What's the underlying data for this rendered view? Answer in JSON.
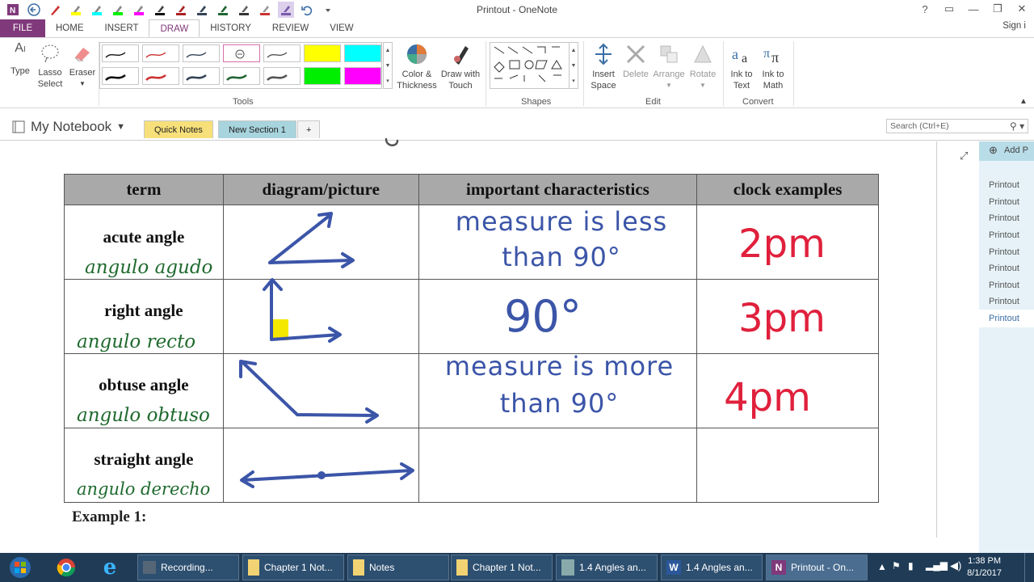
{
  "window": {
    "title": "Printout - OneNote"
  },
  "signin": "Sign i",
  "tabs": [
    "FILE",
    "HOME",
    "INSERT",
    "DRAW",
    "HISTORY",
    "REVIEW",
    "VIEW"
  ],
  "ribbon": {
    "type": "Type",
    "lasso": "Lasso Select",
    "eraser": "Eraser",
    "color_thickness_1": "Color &",
    "color_thickness_2": "Thickness",
    "draw_touch_1": "Draw with",
    "draw_touch_2": "Touch",
    "insert_space_1": "Insert",
    "insert_space_2": "Space",
    "delete": "Delete",
    "arrange": "Arrange",
    "rotate": "Rotate",
    "ink_text_1": "Ink to",
    "ink_text_2": "Text",
    "ink_math_1": "Ink to",
    "ink_math_2": "Math",
    "groups": {
      "tools": "Tools",
      "shapes": "Shapes",
      "edit": "Edit",
      "convert": "Convert"
    }
  },
  "nav": {
    "notebook": "My Notebook",
    "sections": [
      "Quick Notes",
      "New Section 1"
    ],
    "add": "+",
    "search_placeholder": "Search (Ctrl+E)"
  },
  "pages": {
    "add": "Add P",
    "items": [
      "Printout",
      "Printout",
      "Printout",
      "Printout",
      "Printout",
      "Printout",
      "Printout",
      "Printout",
      "Printout"
    ]
  },
  "table": {
    "headers": [
      "term",
      "diagram/picture",
      "important characteristics",
      "clock examples"
    ],
    "rows": [
      {
        "term": "acute angle",
        "spanish": "angulo agudo",
        "characteristics": "measure is less than 90°",
        "clock": "2pm"
      },
      {
        "term": "right angle",
        "spanish": "angulo recto",
        "characteristics": "90°",
        "clock": "3pm"
      },
      {
        "term": "obtuse angle",
        "spanish": "angulo obtuso",
        "characteristics": "measure is more than 90°",
        "clock": "4pm"
      },
      {
        "term": "straight angle",
        "spanish": "angulo derecho",
        "characteristics": "",
        "clock": ""
      }
    ]
  },
  "example": "Example 1:",
  "taskbar": {
    "items": [
      "Recording...",
      "Chapter 1 Not...",
      "Notes",
      "Chapter 1 Not...",
      "1.4 Angles an...",
      "1.4 Angles an...",
      "Printout - On..."
    ],
    "time": "1:38 PM",
    "date": "8/1/2017"
  },
  "colors": {
    "file_tab": "#80397b",
    "ink_blue": "#3b55a8",
    "ink_green": "#1f6a2e",
    "ink_red": "#e0203c",
    "taskbar": "#1f3b56"
  }
}
